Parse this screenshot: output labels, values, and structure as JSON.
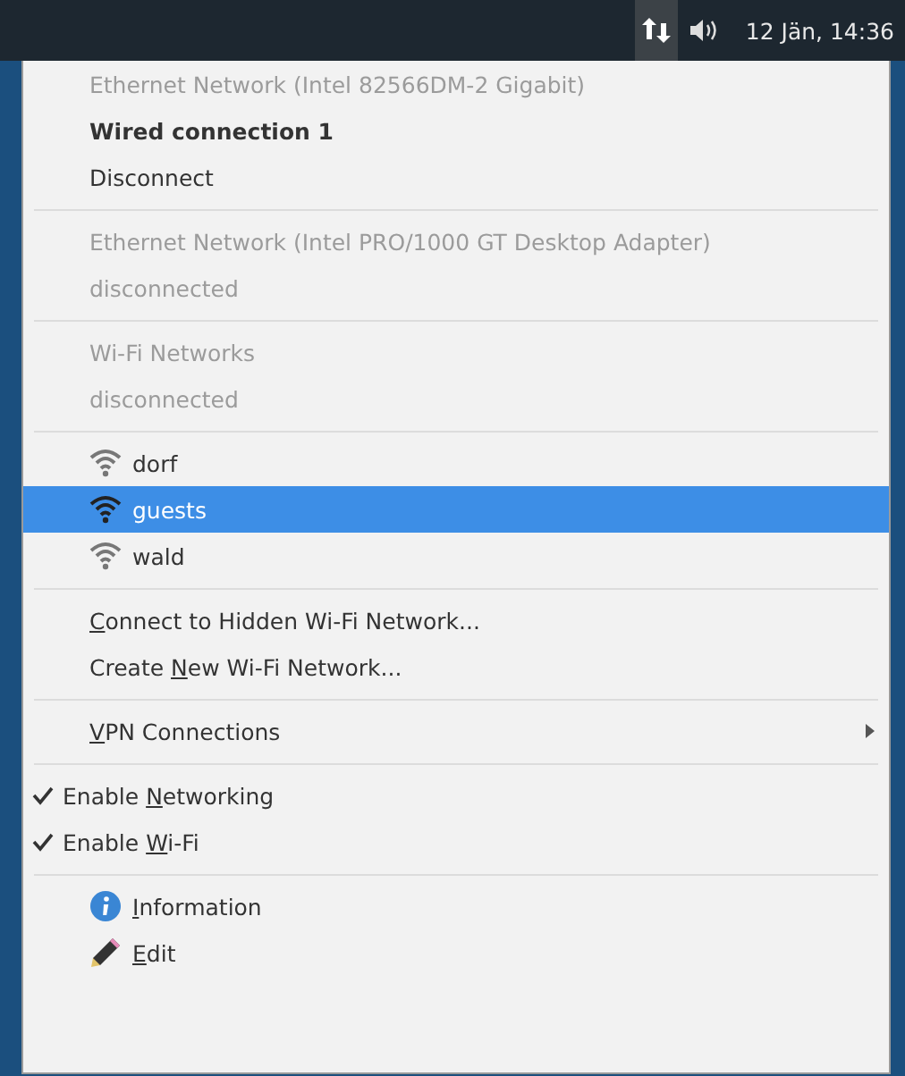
{
  "top_bar": {
    "clock": "12 Jän, 14:36",
    "network_active": true
  },
  "menu": {
    "items": [
      {
        "kind": "header",
        "label": {
          "before": "Ethernet Network (Intel 82566DM-2 Gigabit)"
        }
      },
      {
        "kind": "item",
        "label": {
          "before": "Wired connection 1"
        },
        "bold": true
      },
      {
        "kind": "item",
        "label": {
          "before": "Disconnect"
        },
        "bold": false
      },
      {
        "kind": "separator"
      },
      {
        "kind": "header",
        "label": {
          "before": "Ethernet Network (Intel PRO/1000 GT Desktop Adapter)"
        }
      },
      {
        "kind": "header",
        "label": {
          "before": "disconnected"
        }
      },
      {
        "kind": "separator"
      },
      {
        "kind": "header",
        "label": {
          "before": "Wi-Fi Networks"
        }
      },
      {
        "kind": "header",
        "label": {
          "before": "disconnected"
        }
      },
      {
        "kind": "separator"
      },
      {
        "kind": "network",
        "label": {
          "before": "dorf"
        },
        "selected": false
      },
      {
        "kind": "network",
        "label": {
          "before": "guests"
        },
        "selected": true
      },
      {
        "kind": "network",
        "label": {
          "before": "wald"
        },
        "selected": false
      },
      {
        "kind": "separator"
      },
      {
        "kind": "item",
        "label": {
          "key": "C",
          "after": "onnect to Hidden Wi-Fi Network..."
        },
        "bold": false
      },
      {
        "kind": "item",
        "label": {
          "before": "Create ",
          "key": "N",
          "after": "ew Wi-Fi Network..."
        },
        "bold": false
      },
      {
        "kind": "separator"
      },
      {
        "kind": "submenu",
        "label": {
          "key": "V",
          "after": "PN Connections"
        }
      },
      {
        "kind": "separator"
      },
      {
        "kind": "check",
        "label": {
          "before": "Enable ",
          "key": "N",
          "after": "etworking"
        },
        "checked": true
      },
      {
        "kind": "check",
        "label": {
          "before": "Enable ",
          "key": "W",
          "after": "i-Fi"
        },
        "checked": true
      },
      {
        "kind": "separator"
      },
      {
        "kind": "info",
        "label": {
          "key": "I",
          "after": "nformation"
        }
      },
      {
        "kind": "edit",
        "label": {
          "key": "E",
          "after": "dit"
        }
      }
    ]
  }
}
